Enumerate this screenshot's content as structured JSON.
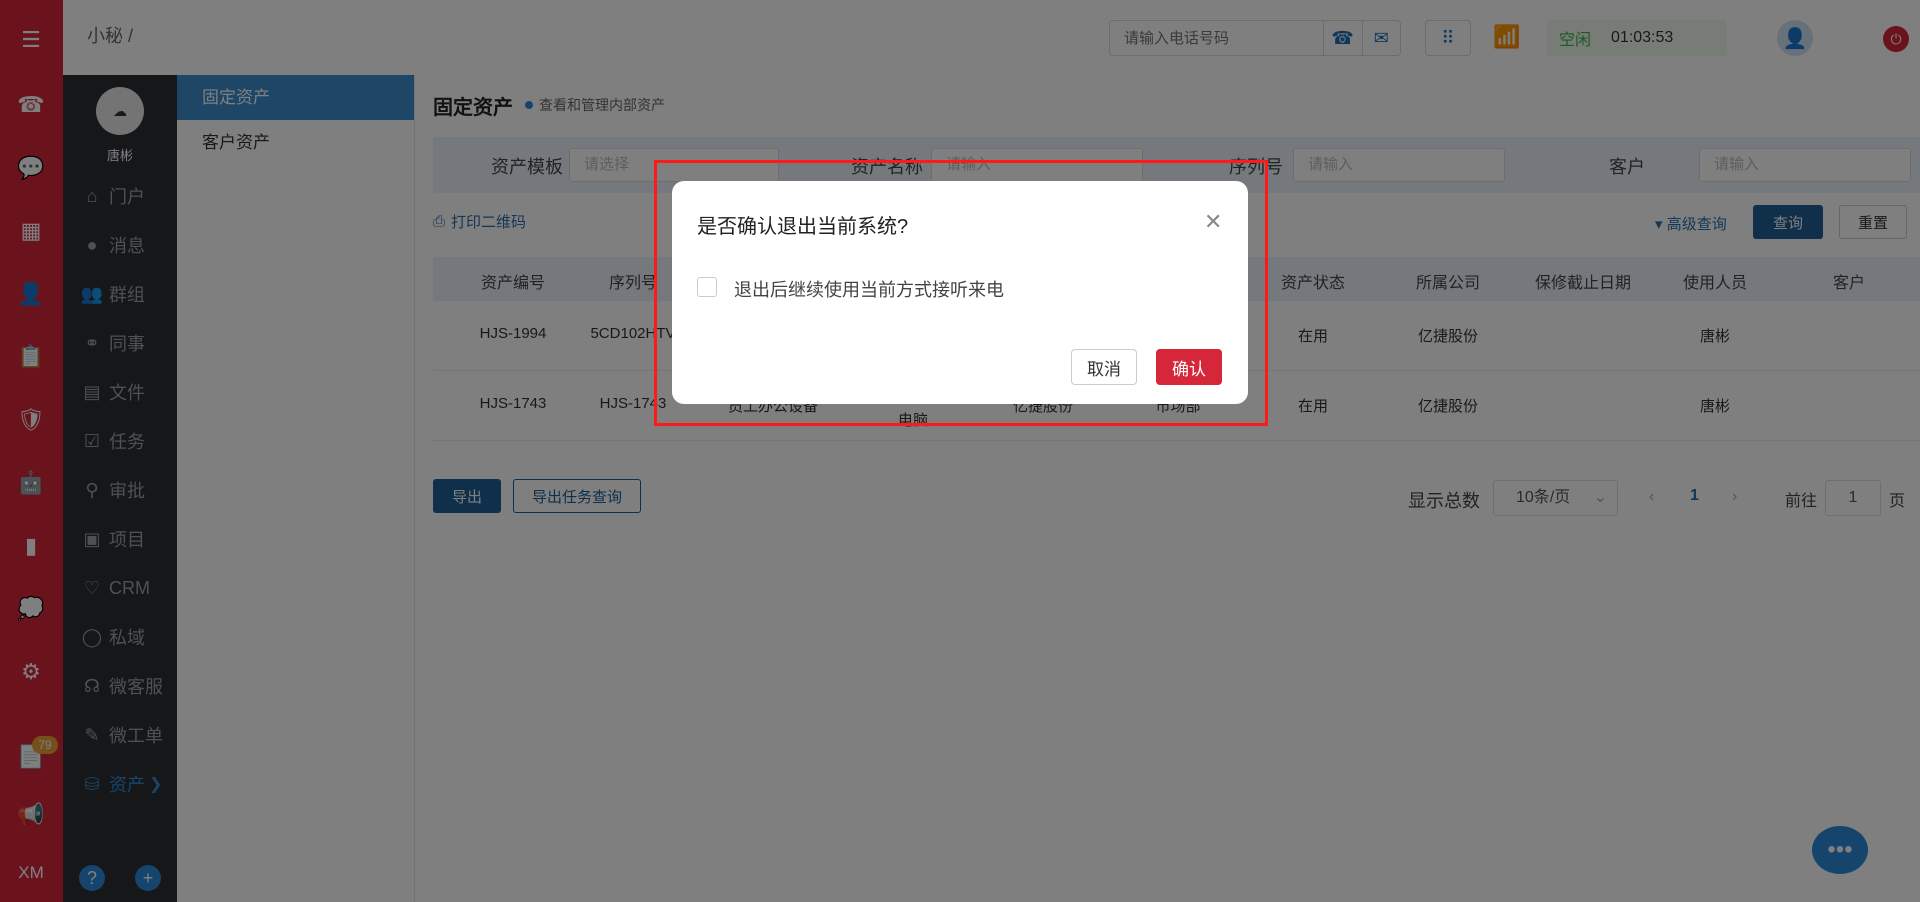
{
  "topbar": {
    "breadcrumb": "小秘  /",
    "phone_placeholder": "请输入电话号码",
    "status_idle": "空闲",
    "status_time": "01:03:53"
  },
  "rail": {
    "badge_count": "79",
    "bottom_label": "XM"
  },
  "nav": {
    "user_name": "唐彬",
    "items": [
      {
        "label": "门户",
        "icon": "home-icon"
      },
      {
        "label": "消息",
        "icon": "message-icon"
      },
      {
        "label": "群组",
        "icon": "group-icon"
      },
      {
        "label": "同事",
        "icon": "colleague-icon"
      },
      {
        "label": "文件",
        "icon": "file-icon"
      },
      {
        "label": "任务",
        "icon": "task-icon"
      },
      {
        "label": "审批",
        "icon": "approval-icon"
      },
      {
        "label": "项目",
        "icon": "project-icon"
      },
      {
        "label": "CRM",
        "icon": "crm-icon"
      },
      {
        "label": "私域",
        "icon": "private-domain-icon"
      },
      {
        "label": "微客服",
        "icon": "customer-service-icon"
      },
      {
        "label": "微工单",
        "icon": "work-order-icon"
      },
      {
        "label": "资产",
        "icon": "asset-icon"
      }
    ]
  },
  "submenu": {
    "items": [
      "固定资产",
      "客户资产"
    ]
  },
  "main": {
    "title": "固定资产",
    "subtitle": "查看和管理内部资产",
    "filters": {
      "template_label": "资产模板",
      "template_placeholder": "请选择",
      "name_label": "资产名称",
      "name_placeholder": "请输入",
      "serial_label": "序列号",
      "serial_placeholder": "请输入",
      "customer_label": "客户",
      "customer_placeholder": "请输入"
    },
    "print_qr": "打印二维码",
    "advanced_query": "高级查询",
    "query_btn": "查询",
    "reset_btn": "重置",
    "columns": [
      "资产编号",
      "序列号",
      "资产状态",
      "所属公司",
      "保修截止日期",
      "使用人员",
      "客户"
    ],
    "rows": [
      {
        "id": "HJS-1994",
        "serial": "5CD102HTV",
        "status": "在用",
        "company": "亿捷股份",
        "warranty": "",
        "user": "唐彬",
        "customer": ""
      },
      {
        "id": "HJS-1743",
        "serial": "HJS-1743",
        "type": "员工办公设备",
        "name": "电脑",
        "company2": "亿捷股份",
        "dept": "市场部",
        "status": "在用",
        "company": "亿捷股份",
        "warranty": "",
        "user": "唐彬",
        "customer": ""
      }
    ],
    "export_btn": "导出",
    "export_task_btn": "导出任务查询",
    "pager": {
      "total_label": "显示总数",
      "page_size": "10条/页",
      "current": "1",
      "goto_label": "前往",
      "goto_value": "1",
      "page_suffix": "页"
    }
  },
  "dialog": {
    "title": "是否确认退出当前系统?",
    "checkbox_label": "退出后继续使用当前方式接听来电",
    "cancel": "取消",
    "confirm": "确认"
  },
  "colors": {
    "brand_red": "#d6263a",
    "nav_dark": "#2d2f33",
    "accent_blue": "#3d8fce",
    "highlight_red": "#ff1a1a"
  }
}
